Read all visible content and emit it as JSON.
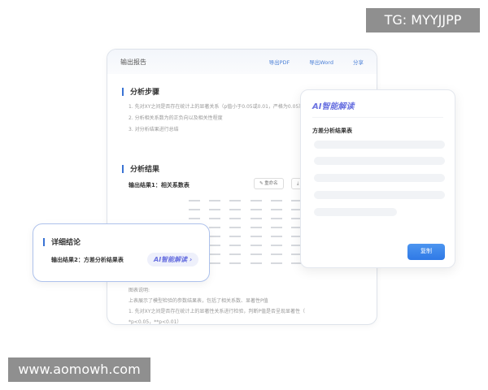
{
  "watermarks": {
    "top": "TG: MYYJJPP",
    "bottom": "www.aomowh.com"
  },
  "report": {
    "title": "输出报告",
    "actions": [
      "导出PDF",
      "导出Word",
      "分享"
    ],
    "steps_heading": "分析步骤",
    "steps": [
      "1. 先对XY之间是否存在统计上的显著关系（p值小于0.05或0.01，严格为0.05）进行检验",
      "2. 分析相关系数为的正负向以及相关性程度",
      "3. 对分析结果进行总结"
    ],
    "results_heading": "分析结果",
    "result1_title": "输出结果1：相关系数表",
    "rename_label": "重命名",
    "download_label": "⤓",
    "chart_note_title": "图表说明:",
    "chart_notes": [
      "上表展示了模型检验的参数结果表，包括了相关系数、显著性P值",
      "1. 先对XY之间是否存在统计上的显著性关系进行检验，判断P值是否呈现显著性（",
      "*p<0.05，**p<0.01）"
    ]
  },
  "ai_panel": {
    "title": "AI智能解读",
    "subtitle": "方差分析结果表",
    "copy_label": "复制"
  },
  "detail": {
    "heading": "详细结论",
    "result2_title": "输出结果2：方差分析结果表",
    "ai_button": "AI智能解读 ›"
  },
  "colors": {
    "accent": "#3a73d4",
    "ai": "#6a72e0",
    "copy": "#2f79e6"
  }
}
